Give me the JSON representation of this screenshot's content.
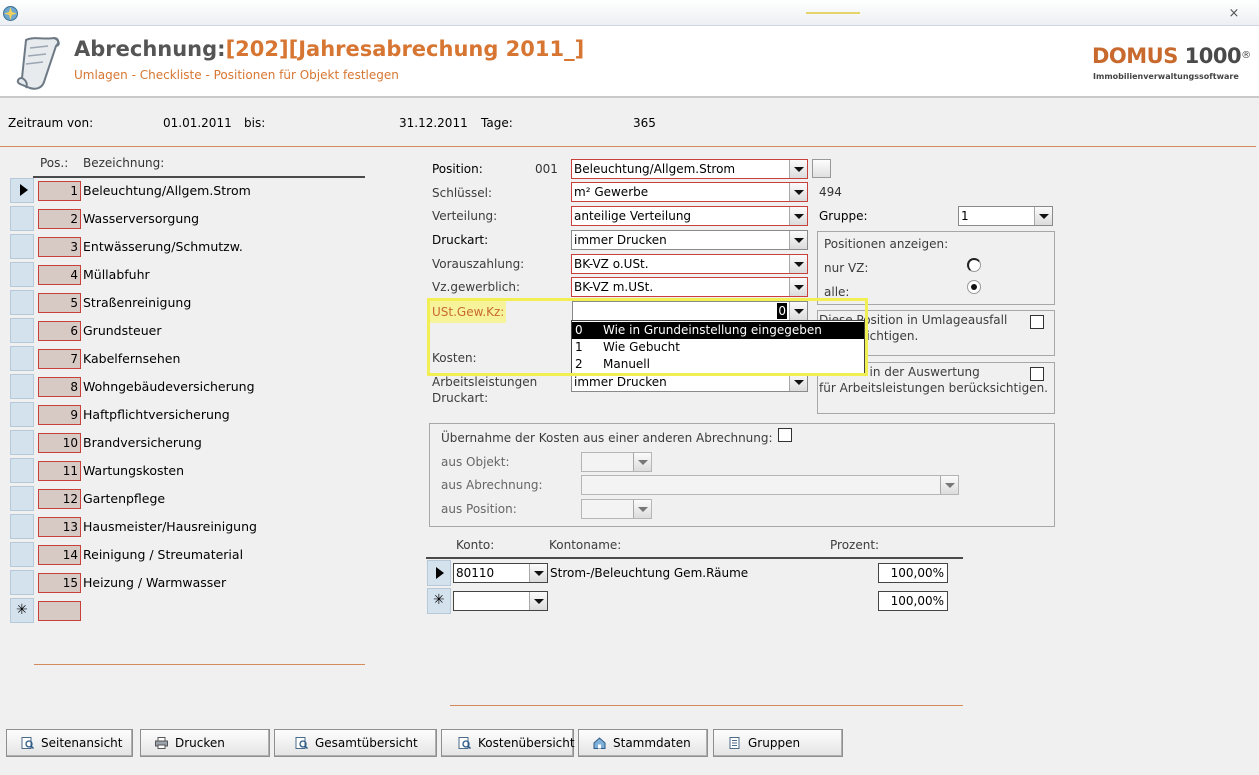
{
  "window": {
    "close_glyph": "×"
  },
  "header": {
    "title_prefix": "Abrechnung:",
    "title_detail": "[202][Jahresabrechung 2011_]",
    "subtitle": "Umlagen - Checkliste - Positionen für Objekt festlegen",
    "logo_text": "DOMUS ",
    "logo_number": "1000",
    "logo_reg": "®",
    "logo_tagline": "Immobilienverwaltungssoftware"
  },
  "period": {
    "from_label": "Zeitraum von:",
    "from_value": "01.01.2011",
    "to_label": "bis:",
    "to_value": "31.12.2011",
    "days_label": "Tage:",
    "days_value": "365"
  },
  "list": {
    "col_pos": "Pos.:",
    "col_name": "Bezeichnung:",
    "current_marker": "▶",
    "new_marker": "✳",
    "rows": [
      {
        "num": "1",
        "name": "Beleuchtung/Allgem.Strom"
      },
      {
        "num": "2",
        "name": "Wasserversorgung"
      },
      {
        "num": "3",
        "name": "Entwässerung/Schmutzw."
      },
      {
        "num": "4",
        "name": "Müllabfuhr"
      },
      {
        "num": "5",
        "name": "Straßenreinigung"
      },
      {
        "num": "6",
        "name": "Grundsteuer"
      },
      {
        "num": "7",
        "name": "Kabelfernsehen"
      },
      {
        "num": "8",
        "name": "Wohngebäudeversicherung"
      },
      {
        "num": "9",
        "name": "Haftpflichtversicherung"
      },
      {
        "num": "10",
        "name": "Brandversicherung"
      },
      {
        "num": "11",
        "name": "Wartungskosten"
      },
      {
        "num": "12",
        "name": "Gartenpflege"
      },
      {
        "num": "13",
        "name": "Hausmeister/Hausreinigung"
      },
      {
        "num": "14",
        "name": "Reinigung / Streumaterial"
      },
      {
        "num": "15",
        "name": "Heizung / Warmwasser"
      }
    ]
  },
  "form": {
    "position_label": "Position:",
    "position_code": "001",
    "position_value": "Beleuchtung/Allgem.Strom",
    "schluessel_label": "Schlüssel:",
    "schluessel_value": "m² Gewerbe",
    "schluessel_count": "494",
    "verteilung_label": "Verteilung:",
    "verteilung_value": "anteilige Verteilung",
    "druckart_label": "Druckart:",
    "druckart_value": "immer Drucken",
    "vorauszahlung_label": "Vorauszahlung:",
    "vorauszahlung_value": "BK-VZ o.USt.",
    "vzgewerblich_label": "Vz.gewerblich:",
    "vzgewerblich_value": "BK-VZ m.USt.",
    "ust_label": "USt.Gew.Kz:",
    "ust_value": "0",
    "kosten_label": "Kosten:",
    "arbeit_label_1": "Arbeitsleistungen",
    "arbeit_label_2": "Druckart:",
    "arbeit_value": "immer Drucken",
    "gruppe_label": "Gruppe:",
    "gruppe_value": "1",
    "anzeigen_title": "Positionen anzeigen:",
    "nur_vz_label": "nur VZ:",
    "alle_label": "alle:",
    "umlage_text_1": "Diese Position in Umlageausfall",
    "umlage_text_2": "berücksichtigen.",
    "auswertung_text_1": "Position in der Auswertung",
    "auswertung_text_2": "für Arbeitsleistungen berücksichtigen."
  },
  "ust_dropdown": {
    "options": [
      {
        "code": "0",
        "text": "Wie in Grundeinstellung eingegeben"
      },
      {
        "code": "1",
        "text": "Wie Gebucht"
      },
      {
        "code": "2",
        "text": "Manuell"
      }
    ]
  },
  "uebernahme": {
    "title": "Übernahme der Kosten aus einer anderen Abrechnung:",
    "objekt_label": "aus Objekt:",
    "abrechnung_label": "aus Abrechnung:",
    "position_label": "aus Position:"
  },
  "konto": {
    "col_konto": "Konto:",
    "col_name": "Kontoname:",
    "col_pct": "Prozent:",
    "rows": [
      {
        "konto": "80110",
        "name": "Strom-/Beleuchtung Gem.Räume",
        "pct": "100,00%"
      },
      {
        "konto": "",
        "name": "",
        "pct": "100,00%"
      }
    ]
  },
  "buttons": {
    "seitenansicht": "Seitenansicht",
    "drucken": "Drucken",
    "gesamt": "Gesamtübersicht",
    "kosten": "Kostenübersicht",
    "stamm": "Stammdaten",
    "gruppen": "Gruppen"
  },
  "colors": {
    "accent_orange": "#d77632",
    "required_border": "#c8403a",
    "highlight_yellow": "#f2ef55"
  }
}
